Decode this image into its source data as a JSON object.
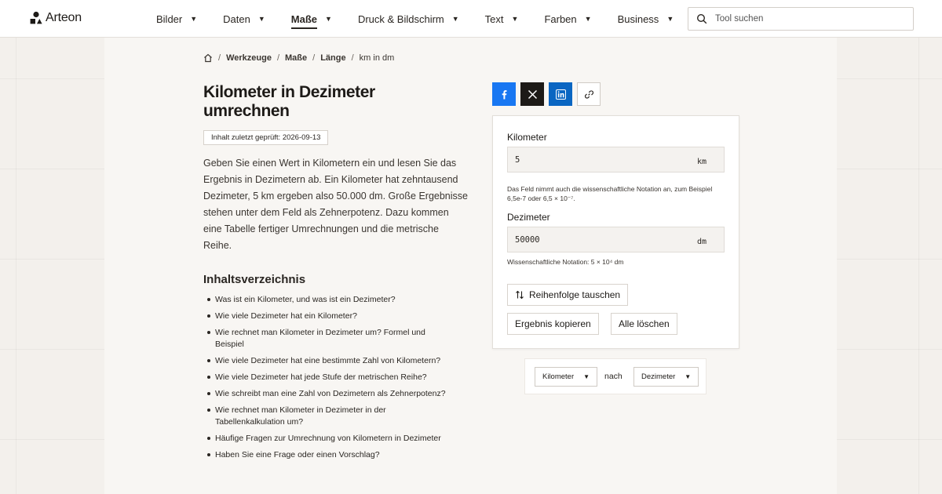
{
  "brand": {
    "name": "Arteon",
    "logo_icon": "trefoil-logo-icon"
  },
  "nav": [
    {
      "label": "Bilder",
      "active": false
    },
    {
      "label": "Daten",
      "active": false
    },
    {
      "label": "Maße",
      "active": true
    },
    {
      "label": "Druck & Bildschirm",
      "active": false
    },
    {
      "label": "Text",
      "active": false
    },
    {
      "label": "Farben",
      "active": false
    },
    {
      "label": "Business",
      "active": false
    }
  ],
  "search": {
    "placeholder": "Tool suchen",
    "value": ""
  },
  "breadcrumb": {
    "home_icon": "home-icon",
    "items": [
      "Werkzeuge",
      "Maße",
      "Länge"
    ],
    "current": "km in dm"
  },
  "page": {
    "title": "Kilometer in Dezimeter umrechnen",
    "checked_badge": "Inhalt zuletzt geprüft: 2026-09-13",
    "intro": "Geben Sie einen Wert in Kilometern ein und lesen Sie das Ergebnis in Dezimetern ab. Ein Kilometer hat zehntausend Dezimeter, 5 km ergeben also 50.000 dm. Große Ergebnisse stehen unter dem Feld als Zehnerpotenz. Dazu kommen eine Tabelle fertiger Umrechnungen und die metrische Reihe."
  },
  "toc": {
    "title": "Inhaltsverzeichnis",
    "items": [
      "Was ist ein Kilometer, und was ist ein Dezimeter?",
      "Wie viele Dezimeter hat ein Kilometer?",
      "Wie rechnet man Kilometer in Dezimeter um? Formel und Beispiel",
      "Wie viele Dezimeter hat eine bestimmte Zahl von Kilometern?",
      "Wie viele Dezimeter hat jede Stufe der metrischen Reihe?",
      "Wie schreibt man eine Zahl von Dezimetern als Zehnerpotenz?",
      "Wie rechnet man Kilometer in Dezimeter in der Tabellenkalkulation um?",
      "Häufige Fragen zur Umrechnung von Kilometern in Dezimeter",
      "Haben Sie eine Frage oder einen Vorschlag?"
    ]
  },
  "share": {
    "icons": [
      "facebook-icon",
      "x-icon",
      "linkedin-icon",
      "link-icon"
    ],
    "colors": {
      "facebook": "#1877f2",
      "x": "#1d1a17",
      "linkedin": "#0a66c2"
    }
  },
  "converter": {
    "from": {
      "label": "Kilometer",
      "value": "5",
      "unit": "km",
      "hint": "Das Feld nimmt auch die wissenschaftliche Notation an, zum Beispiel 6,5e-7 oder 6,5 × 10⁻⁷."
    },
    "to": {
      "label": "Dezimeter",
      "value": "50000",
      "unit": "dm",
      "hint": "Wissenschaftliche Notation: 5 × 10⁴ dm"
    },
    "swap_label": "Reihenfolge tauschen",
    "copy_label": "Ergebnis kopieren",
    "clear_label": "Alle löschen"
  },
  "unit_selector": {
    "from": "Kilometer",
    "connector": "nach",
    "to": "Dezimeter"
  }
}
